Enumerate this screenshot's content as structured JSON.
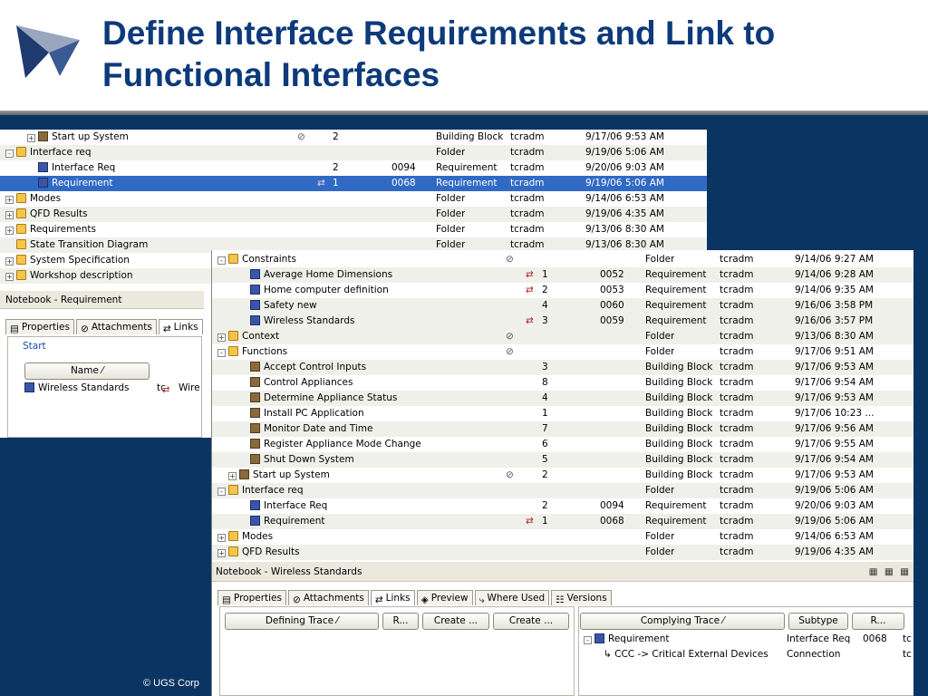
{
  "slide": {
    "title_line1": "Define Interface Requirements and Link to",
    "title_line2": "Functional Interfaces",
    "copyright": "© UGS Corp"
  },
  "back_window": {
    "rows": [
      {
        "name": "Start up System",
        "icon": "building-block-icon",
        "indent": 2,
        "toggle": "+",
        "clip": true,
        "num": "2",
        "id": "",
        "type": "Building Block",
        "owner": "tcradm",
        "date": "9/17/06 9:53 AM"
      },
      {
        "name": "Interface req",
        "icon": "folder-icon",
        "indent": 0,
        "toggle": "-",
        "num": "",
        "id": "",
        "type": "Folder",
        "owner": "tcradm",
        "date": "9/19/06 5:06 AM"
      },
      {
        "name": "Interface Req",
        "icon": "requirement-icon",
        "indent": 2,
        "num": "2",
        "id": "0094",
        "type": "Requirement",
        "owner": "tcradm",
        "date": "9/20/06 9:03 AM"
      },
      {
        "name": "Requirement",
        "icon": "requirement-icon",
        "indent": 2,
        "trace": true,
        "num": "1",
        "id": "0068",
        "type": "Requirement",
        "owner": "tcradm",
        "date": "9/19/06 5:06 AM",
        "selected": true
      },
      {
        "name": "Modes",
        "icon": "folder-icon",
        "indent": 0,
        "toggle": "+",
        "num": "",
        "id": "",
        "type": "Folder",
        "owner": "tcradm",
        "date": "9/14/06 6:53 AM"
      },
      {
        "name": "QFD Results",
        "icon": "folder-icon",
        "indent": 0,
        "toggle": "+",
        "num": "",
        "id": "",
        "type": "Folder",
        "owner": "tcradm",
        "date": "9/19/06 4:35 AM"
      },
      {
        "name": "Requirements",
        "icon": "folder-icon",
        "indent": 0,
        "toggle": "+",
        "num": "",
        "id": "",
        "type": "Folder",
        "owner": "tcradm",
        "date": "9/13/06 8:30 AM"
      },
      {
        "name": "State Transition Diagram",
        "icon": "folder-icon",
        "indent": 0,
        "num": "",
        "id": "",
        "type": "Folder",
        "owner": "tcradm",
        "date": "9/13/06 8:30 AM"
      },
      {
        "name": "System Specification",
        "icon": "folder-icon",
        "indent": 0,
        "toggle": "+",
        "num": "",
        "id": "",
        "type": "",
        "owner": "",
        "date": ""
      },
      {
        "name": "Workshop description",
        "icon": "folder-icon",
        "indent": 0,
        "toggle": "+",
        "num": "",
        "id": "",
        "type": "",
        "owner": "",
        "date": ""
      }
    ],
    "notebook_title": "Notebook - Requirement",
    "tabs": [
      "Properties",
      "Attachments",
      "Links"
    ],
    "start_label": "Start",
    "name_header": "Name",
    "link_item": "Wireless Standards",
    "link_item_suffix": "tc",
    "right_item": "Wire"
  },
  "front_window": {
    "rows": [
      {
        "name": "Constraints",
        "icon": "folder-icon",
        "indent": 0,
        "toggle": "-",
        "clip": true,
        "num": "",
        "id": "",
        "type": "Folder",
        "owner": "tcradm",
        "date": "9/14/06 9:27 AM"
      },
      {
        "name": "Average Home Dimensions",
        "icon": "requirement-icon",
        "indent": 2,
        "trace": true,
        "num": "1",
        "id": "0052",
        "type": "Requirement",
        "owner": "tcradm",
        "date": "9/14/06 9:28 AM"
      },
      {
        "name": "Home computer definition",
        "icon": "requirement-icon",
        "indent": 2,
        "trace": true,
        "num": "2",
        "id": "0053",
        "type": "Requirement",
        "owner": "tcradm",
        "date": "9/14/06 9:35 AM"
      },
      {
        "name": "Safety new",
        "icon": "requirement-icon",
        "indent": 2,
        "num": "4",
        "id": "0060",
        "type": "Requirement",
        "owner": "tcradm",
        "date": "9/16/06 3:58 PM"
      },
      {
        "name": "Wireless Standards",
        "icon": "requirement-icon",
        "indent": 2,
        "trace": true,
        "num": "3",
        "id": "0059",
        "type": "Requirement",
        "owner": "tcradm",
        "date": "9/16/06 3:57 PM",
        "highlight": true
      },
      {
        "name": "Context",
        "icon": "folder-icon",
        "indent": 0,
        "toggle": "+",
        "clip": true,
        "num": "",
        "id": "",
        "type": "Folder",
        "owner": "tcradm",
        "date": "9/13/06 8:30 AM"
      },
      {
        "name": "Functions",
        "icon": "folder-icon",
        "indent": 0,
        "toggle": "-",
        "clip": true,
        "num": "",
        "id": "",
        "type": "Folder",
        "owner": "tcradm",
        "date": "9/17/06 9:51 AM"
      },
      {
        "name": "Accept Control Inputs",
        "icon": "building-block-icon",
        "indent": 2,
        "num": "3",
        "id": "",
        "type": "Building Block",
        "owner": "tcradm",
        "date": "9/17/06 9:53 AM"
      },
      {
        "name": "Control Appliances",
        "icon": "building-block-icon",
        "indent": 2,
        "num": "8",
        "id": "",
        "type": "Building Block",
        "owner": "tcradm",
        "date": "9/17/06 9:54 AM"
      },
      {
        "name": "Determine Appliance Status",
        "icon": "building-block-icon",
        "indent": 2,
        "num": "4",
        "id": "",
        "type": "Building Block",
        "owner": "tcradm",
        "date": "9/17/06 9:53 AM"
      },
      {
        "name": "Install PC Application",
        "icon": "building-block-icon",
        "indent": 2,
        "num": "1",
        "id": "",
        "type": "Building Block",
        "owner": "tcradm",
        "date": "9/17/06 10:23 ..."
      },
      {
        "name": "Monitor Date and Time",
        "icon": "building-block-icon",
        "indent": 2,
        "num": "7",
        "id": "",
        "type": "Building Block",
        "owner": "tcradm",
        "date": "9/17/06 9:56 AM"
      },
      {
        "name": "Register Appliance Mode Change",
        "icon": "building-block-icon",
        "indent": 2,
        "num": "6",
        "id": "",
        "type": "Building Block",
        "owner": "tcradm",
        "date": "9/17/06 9:55 AM"
      },
      {
        "name": "Shut Down System",
        "icon": "building-block-icon",
        "indent": 2,
        "num": "5",
        "id": "",
        "type": "Building Block",
        "owner": "tcradm",
        "date": "9/17/06 9:54 AM"
      },
      {
        "name": "Start up System",
        "icon": "building-block-icon",
        "indent": 1,
        "toggle": "+",
        "clip": true,
        "num": "2",
        "id": "",
        "type": "Building Block",
        "owner": "tcradm",
        "date": "9/17/06 9:53 AM"
      },
      {
        "name": "Interface req",
        "icon": "folder-icon",
        "indent": 0,
        "toggle": "-",
        "num": "",
        "id": "",
        "type": "Folder",
        "owner": "tcradm",
        "date": "9/19/06 5:06 AM"
      },
      {
        "name": "Interface Req",
        "icon": "requirement-icon",
        "indent": 2,
        "num": "2",
        "id": "0094",
        "type": "Requirement",
        "owner": "tcradm",
        "date": "9/20/06 9:03 AM"
      },
      {
        "name": "Requirement",
        "icon": "requirement-icon",
        "indent": 2,
        "trace": true,
        "num": "1",
        "id": "0068",
        "type": "Requirement",
        "owner": "tcradm",
        "date": "9/19/06 5:06 AM"
      },
      {
        "name": "Modes",
        "icon": "folder-icon",
        "indent": 0,
        "toggle": "+",
        "num": "",
        "id": "",
        "type": "Folder",
        "owner": "tcradm",
        "date": "9/14/06 6:53 AM"
      },
      {
        "name": "QFD Results",
        "icon": "folder-icon",
        "indent": 0,
        "toggle": "+",
        "num": "",
        "id": "",
        "type": "Folder",
        "owner": "tcradm",
        "date": "9/19/06 4:35 AM"
      }
    ],
    "notebook_title": "Notebook - Wireless Standards",
    "tabs": [
      "Properties",
      "Attachments",
      "Links",
      "Preview",
      "Where Used",
      "Versions"
    ],
    "left_headers": [
      "Defining Trace",
      "R...",
      "Create ...",
      "Create ..."
    ],
    "right_headers": [
      "Complying Trace",
      "Subtype",
      "R..."
    ],
    "trace_rows": [
      {
        "name": "Requirement",
        "subtype": "Interface Req",
        "r": "0068",
        "extra": "tc"
      },
      {
        "name": "CCC -> Critical External Devices",
        "subtype": "Connection",
        "r": "",
        "extra": "tc"
      }
    ]
  }
}
